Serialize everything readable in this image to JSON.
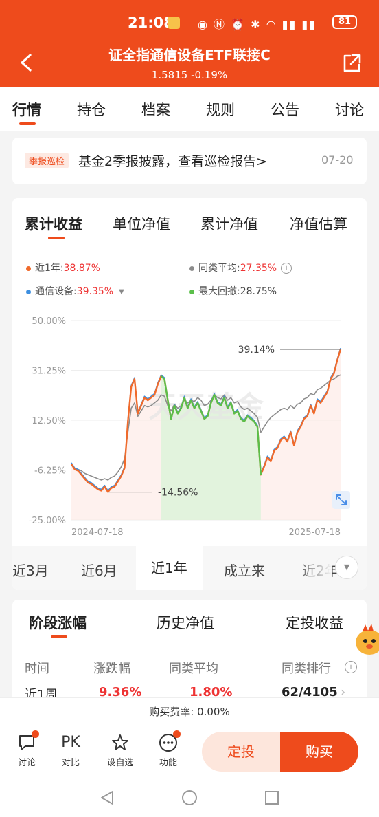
{
  "status": {
    "time": "21:08",
    "battery": "81"
  },
  "header": {
    "title": "证全指通信设备ETF联接C",
    "subtitle": "1.5815 -0.19%"
  },
  "tabs": [
    {
      "label": "行情"
    },
    {
      "label": "持仓"
    },
    {
      "label": "档案"
    },
    {
      "label": "规则"
    },
    {
      "label": "公告"
    },
    {
      "label": "讨论"
    }
  ],
  "notice": {
    "tag": "季报巡检",
    "text": "基金2季报披露，查看巡检报告>",
    "date": "07-20"
  },
  "chart_tabs": [
    {
      "label": "累计收益"
    },
    {
      "label": "单位净值"
    },
    {
      "label": "累计净值"
    },
    {
      "label": "净值估算"
    }
  ],
  "legend": {
    "fund": {
      "label": "近1年:",
      "value": "38.87%",
      "color": "#f06a2b"
    },
    "peer": {
      "label": "同类平均:",
      "value": "27.35%",
      "color": "#8c8c8c"
    },
    "index": {
      "label": "通信设备:",
      "value": "39.35%",
      "color": "#3d8fe0"
    },
    "drawdown": {
      "label": "最大回撤:",
      "value": "28.75%",
      "color": "#5bbf4a"
    }
  },
  "chart_data": {
    "type": "line",
    "ylim": [
      -25,
      50
    ],
    "y_ticks": [
      "50.00%",
      "31.25%",
      "12.50%",
      "-6.25%",
      "-25.00%"
    ],
    "x_labels": [
      "2024-07-18",
      "2025-07-18"
    ],
    "annotations": [
      {
        "text": "39.14%",
        "value": 39.14
      },
      {
        "text": "-14.56%",
        "value": -14.56
      }
    ],
    "watermark": "天天基金",
    "series": [
      {
        "color": "#f06a2b",
        "values": [
          -4.0,
          -6.0,
          -6.5,
          -8.0,
          -9.5,
          -11.0,
          -11.5,
          -12.5,
          -13.5,
          -14.0,
          -12.5,
          -14.5,
          -13.0,
          -12.5,
          -10.5,
          -8.5,
          -5.5,
          12.0,
          25.0,
          28.0,
          15.0,
          18.0,
          21.0,
          20.0,
          21.0,
          22.0,
          26.0,
          29.0,
          28.0,
          20.0,
          13.0,
          18.0,
          15.0,
          17.0,
          21.0,
          17.0,
          20.0,
          17.0,
          19.0,
          16.0,
          13.0,
          14.0,
          19.0,
          22.0,
          19.0,
          18.0,
          21.0,
          17.0,
          19.0,
          15.0,
          16.0,
          13.0,
          12.0,
          14.0,
          13.0,
          12.0,
          10.0,
          -8.0,
          -5.0,
          -1.5,
          -3.0,
          1.0,
          2.0,
          5.0,
          6.0,
          4.5,
          8.0,
          3.0,
          8.0,
          10.0,
          13.0,
          14.0,
          18.0,
          15.0,
          20.0,
          19.0,
          21.0,
          23.0,
          28.0,
          30.0,
          35.0,
          39.14
        ]
      },
      {
        "color": "#3d8fe0",
        "values": [
          -3.5,
          -5.5,
          -6.0,
          -7.5,
          -9.0,
          -10.5,
          -11.0,
          -12.0,
          -13.0,
          -13.5,
          -12.0,
          -14.0,
          -12.5,
          -12.0,
          -10.0,
          -8.0,
          -5.0,
          12.5,
          25.5,
          28.5,
          15.5,
          18.5,
          21.5,
          20.5,
          21.5,
          22.5,
          26.5,
          29.5,
          28.5,
          20.5,
          13.5,
          18.5,
          15.5,
          17.5,
          21.5,
          17.5,
          20.5,
          17.5,
          19.5,
          16.5,
          13.5,
          14.5,
          19.5,
          22.5,
          19.5,
          18.5,
          21.5,
          17.5,
          19.5,
          15.5,
          16.5,
          13.5,
          12.5,
          14.5,
          13.5,
          12.5,
          10.5,
          -7.5,
          -4.5,
          -1.0,
          -2.5,
          1.5,
          2.5,
          5.5,
          6.5,
          5.0,
          8.5,
          3.5,
          8.5,
          10.5,
          13.5,
          14.5,
          18.5,
          15.5,
          20.5,
          19.5,
          21.5,
          23.5,
          28.5,
          30.5,
          35.5,
          39.6
        ]
      },
      {
        "color": "#8c8c8c",
        "values": [
          -4.0,
          -5.5,
          -6.0,
          -6.5,
          -7.5,
          -8.0,
          -8.5,
          -9.0,
          -9.5,
          -10.0,
          -9.5,
          -10.0,
          -9.0,
          -8.5,
          -7.0,
          -5.0,
          -2.0,
          8.0,
          17.0,
          19.0,
          14.0,
          16.0,
          18.0,
          17.5,
          18.0,
          19.0,
          20.0,
          22.0,
          21.5,
          18.0,
          16.0,
          18.5,
          17.0,
          18.0,
          20.0,
          19.0,
          20.0,
          19.5,
          21.0,
          20.0,
          18.0,
          18.5,
          20.0,
          22.0,
          21.0,
          20.5,
          22.0,
          20.0,
          21.0,
          19.0,
          19.5,
          17.5,
          16.5,
          17.0,
          16.0,
          15.0,
          13.5,
          8.0,
          10.0,
          12.0,
          13.5,
          14.5,
          15.5,
          16.5,
          17.0,
          16.5,
          18.0,
          17.0,
          18.5,
          19.0,
          20.5,
          21.0,
          22.5,
          22.0,
          24.0,
          24.5,
          25.5,
          26.5,
          27.5,
          28.0,
          29.0,
          29.5
        ]
      }
    ]
  },
  "periods": [
    {
      "label": "近3月"
    },
    {
      "label": "近6月"
    },
    {
      "label": "近1年"
    },
    {
      "label": "成立来"
    },
    {
      "label": "近2年"
    }
  ],
  "stage": {
    "tabs": [
      {
        "label": "阶段涨幅"
      },
      {
        "label": "历史净值"
      },
      {
        "label": "定投收益"
      }
    ],
    "headers": [
      "时间",
      "涨跌幅",
      "同类平均",
      "同类排行"
    ],
    "row": {
      "period": "近1周",
      "change": "9.36%",
      "avg": "1.80%",
      "rank": "62/4105"
    }
  },
  "fee": "购买费率: 0.00%",
  "bottom": {
    "items": [
      {
        "label": "讨论"
      },
      {
        "label": "对比",
        "icon_text": "PK"
      },
      {
        "label": "设自选"
      },
      {
        "label": "功能"
      }
    ],
    "dingtou": "定投",
    "buy": "购买"
  }
}
